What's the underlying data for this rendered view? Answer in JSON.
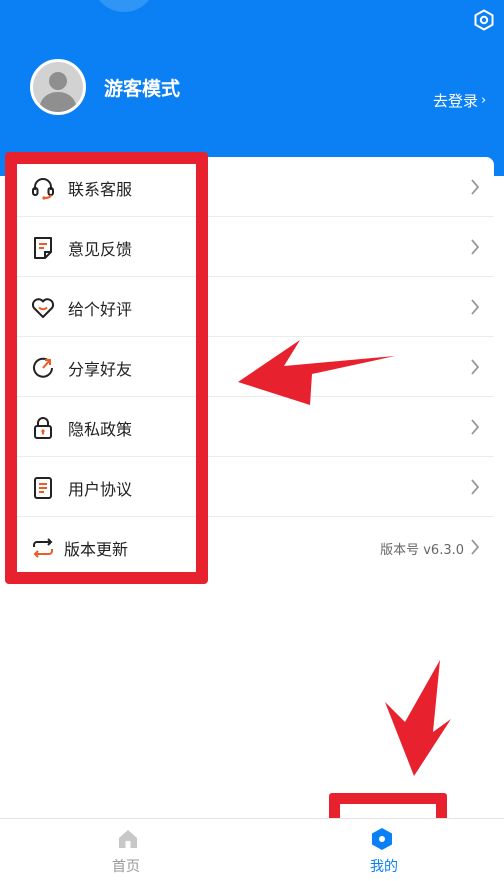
{
  "profile": {
    "username": "游客模式",
    "login_label": "去登录",
    "login_chevron": "›"
  },
  "header": {
    "accent_color": "#0b80f5",
    "settings_icon": "settings-hexagon-icon"
  },
  "menu": {
    "items": [
      {
        "label": "联系客服",
        "icon": "headset-icon"
      },
      {
        "label": "意见反馈",
        "icon": "feedback-note-icon"
      },
      {
        "label": "给个好评",
        "icon": "heart-icon"
      },
      {
        "label": "分享好友",
        "icon": "share-circle-icon"
      },
      {
        "label": "隐私政策",
        "icon": "lock-icon"
      },
      {
        "label": "用户协议",
        "icon": "document-lines-icon"
      },
      {
        "label": "版本更新",
        "icon": "refresh-arrows-icon",
        "value": "版本号 v6.3.0"
      }
    ],
    "icon_accent_color": "#f15a24"
  },
  "bottom_nav": {
    "items": [
      {
        "label": "首页",
        "icon": "home-icon",
        "active": false
      },
      {
        "label": "我的",
        "icon": "mine-hexagon-icon",
        "active": true
      }
    ]
  },
  "annotation": {
    "color": "#e8212e"
  }
}
